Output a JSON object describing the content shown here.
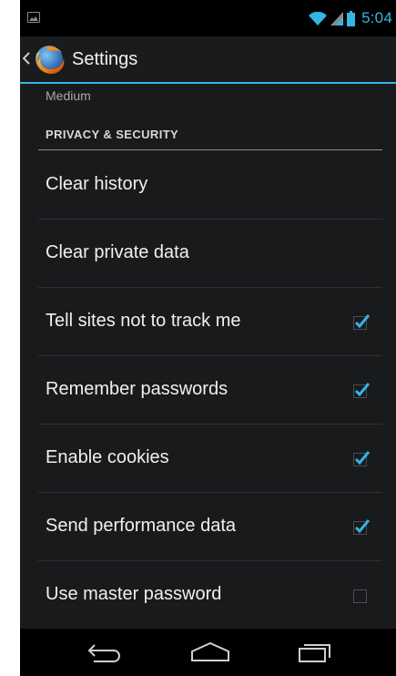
{
  "status_bar": {
    "time": "5:04",
    "icons": [
      "picture-notification-icon",
      "wifi-icon",
      "signal-icon",
      "battery-icon"
    ],
    "accent_color": "#33b5e5"
  },
  "action_bar": {
    "title": "Settings",
    "icons": [
      "up-caret-icon",
      "firefox-logo-icon"
    ]
  },
  "list": {
    "previous_summary": "Medium",
    "category": "PRIVACY & SECURITY",
    "items": [
      {
        "label": "Clear history",
        "has_checkbox": false
      },
      {
        "label": "Clear private data",
        "has_checkbox": false
      },
      {
        "label": "Tell sites not to track me",
        "has_checkbox": true,
        "checked": true
      },
      {
        "label": "Remember passwords",
        "has_checkbox": true,
        "checked": true
      },
      {
        "label": "Enable cookies",
        "has_checkbox": true,
        "checked": true
      },
      {
        "label": "Send performance data",
        "has_checkbox": true,
        "checked": true
      },
      {
        "label": "Use master password",
        "has_checkbox": true,
        "checked": false
      }
    ]
  },
  "nav_bar": {
    "buttons": [
      "back-icon",
      "home-icon",
      "recent-apps-icon"
    ]
  }
}
